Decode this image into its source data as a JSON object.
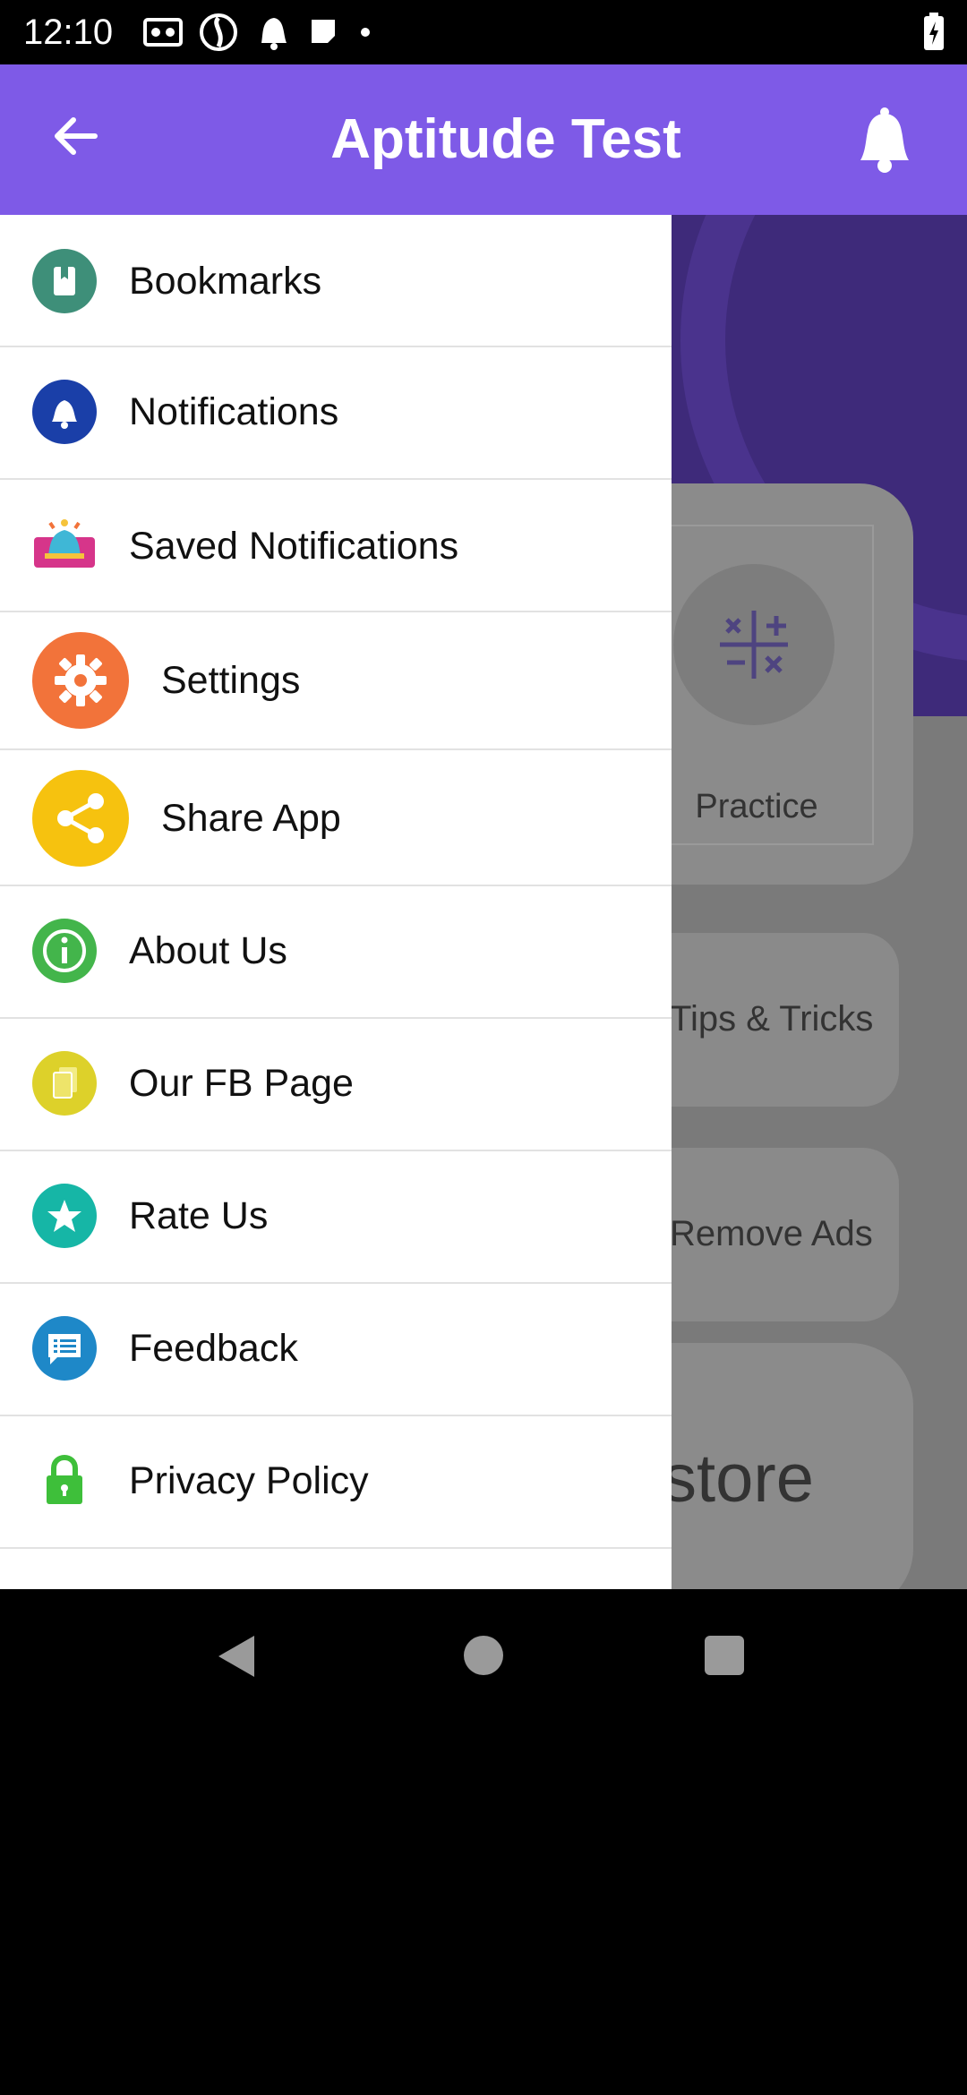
{
  "status_bar": {
    "time": "12:10"
  },
  "app_bar": {
    "title": "Aptitude Test",
    "back_icon": "arrow-back-icon",
    "bell_icon": "bell-icon",
    "color": "#7E5AE7"
  },
  "background": {
    "practice_label": "Practice",
    "tips_label": "Tips & Tricks",
    "ads_label": "Remove Ads",
    "store_label": "store"
  },
  "drawer": {
    "items": [
      {
        "label": "Bookmarks",
        "icon": "bookmark-icon",
        "color": "#3E8F79"
      },
      {
        "label": "Notifications",
        "icon": "bell-icon",
        "color": "#1A3FA8"
      },
      {
        "label": "Saved Notifications",
        "icon": "saved-bell-icon",
        "color": "#D6358A"
      },
      {
        "label": "Settings",
        "icon": "gear-icon",
        "color": "#F2733A"
      },
      {
        "label": "Share App",
        "icon": "share-icon",
        "color": "#F6C20F"
      },
      {
        "label": "About Us",
        "icon": "info-icon",
        "color": "#43B54B"
      },
      {
        "label": "Our FB Page",
        "icon": "pages-icon",
        "color": "#DDD12A"
      },
      {
        "label": "Rate Us",
        "icon": "star-icon",
        "color": "#16B6A6"
      },
      {
        "label": "Feedback",
        "icon": "feedback-icon",
        "color": "#1E88C8"
      },
      {
        "label": "Privacy Policy",
        "icon": "lock-icon",
        "color": "#3EBF3A"
      }
    ]
  }
}
